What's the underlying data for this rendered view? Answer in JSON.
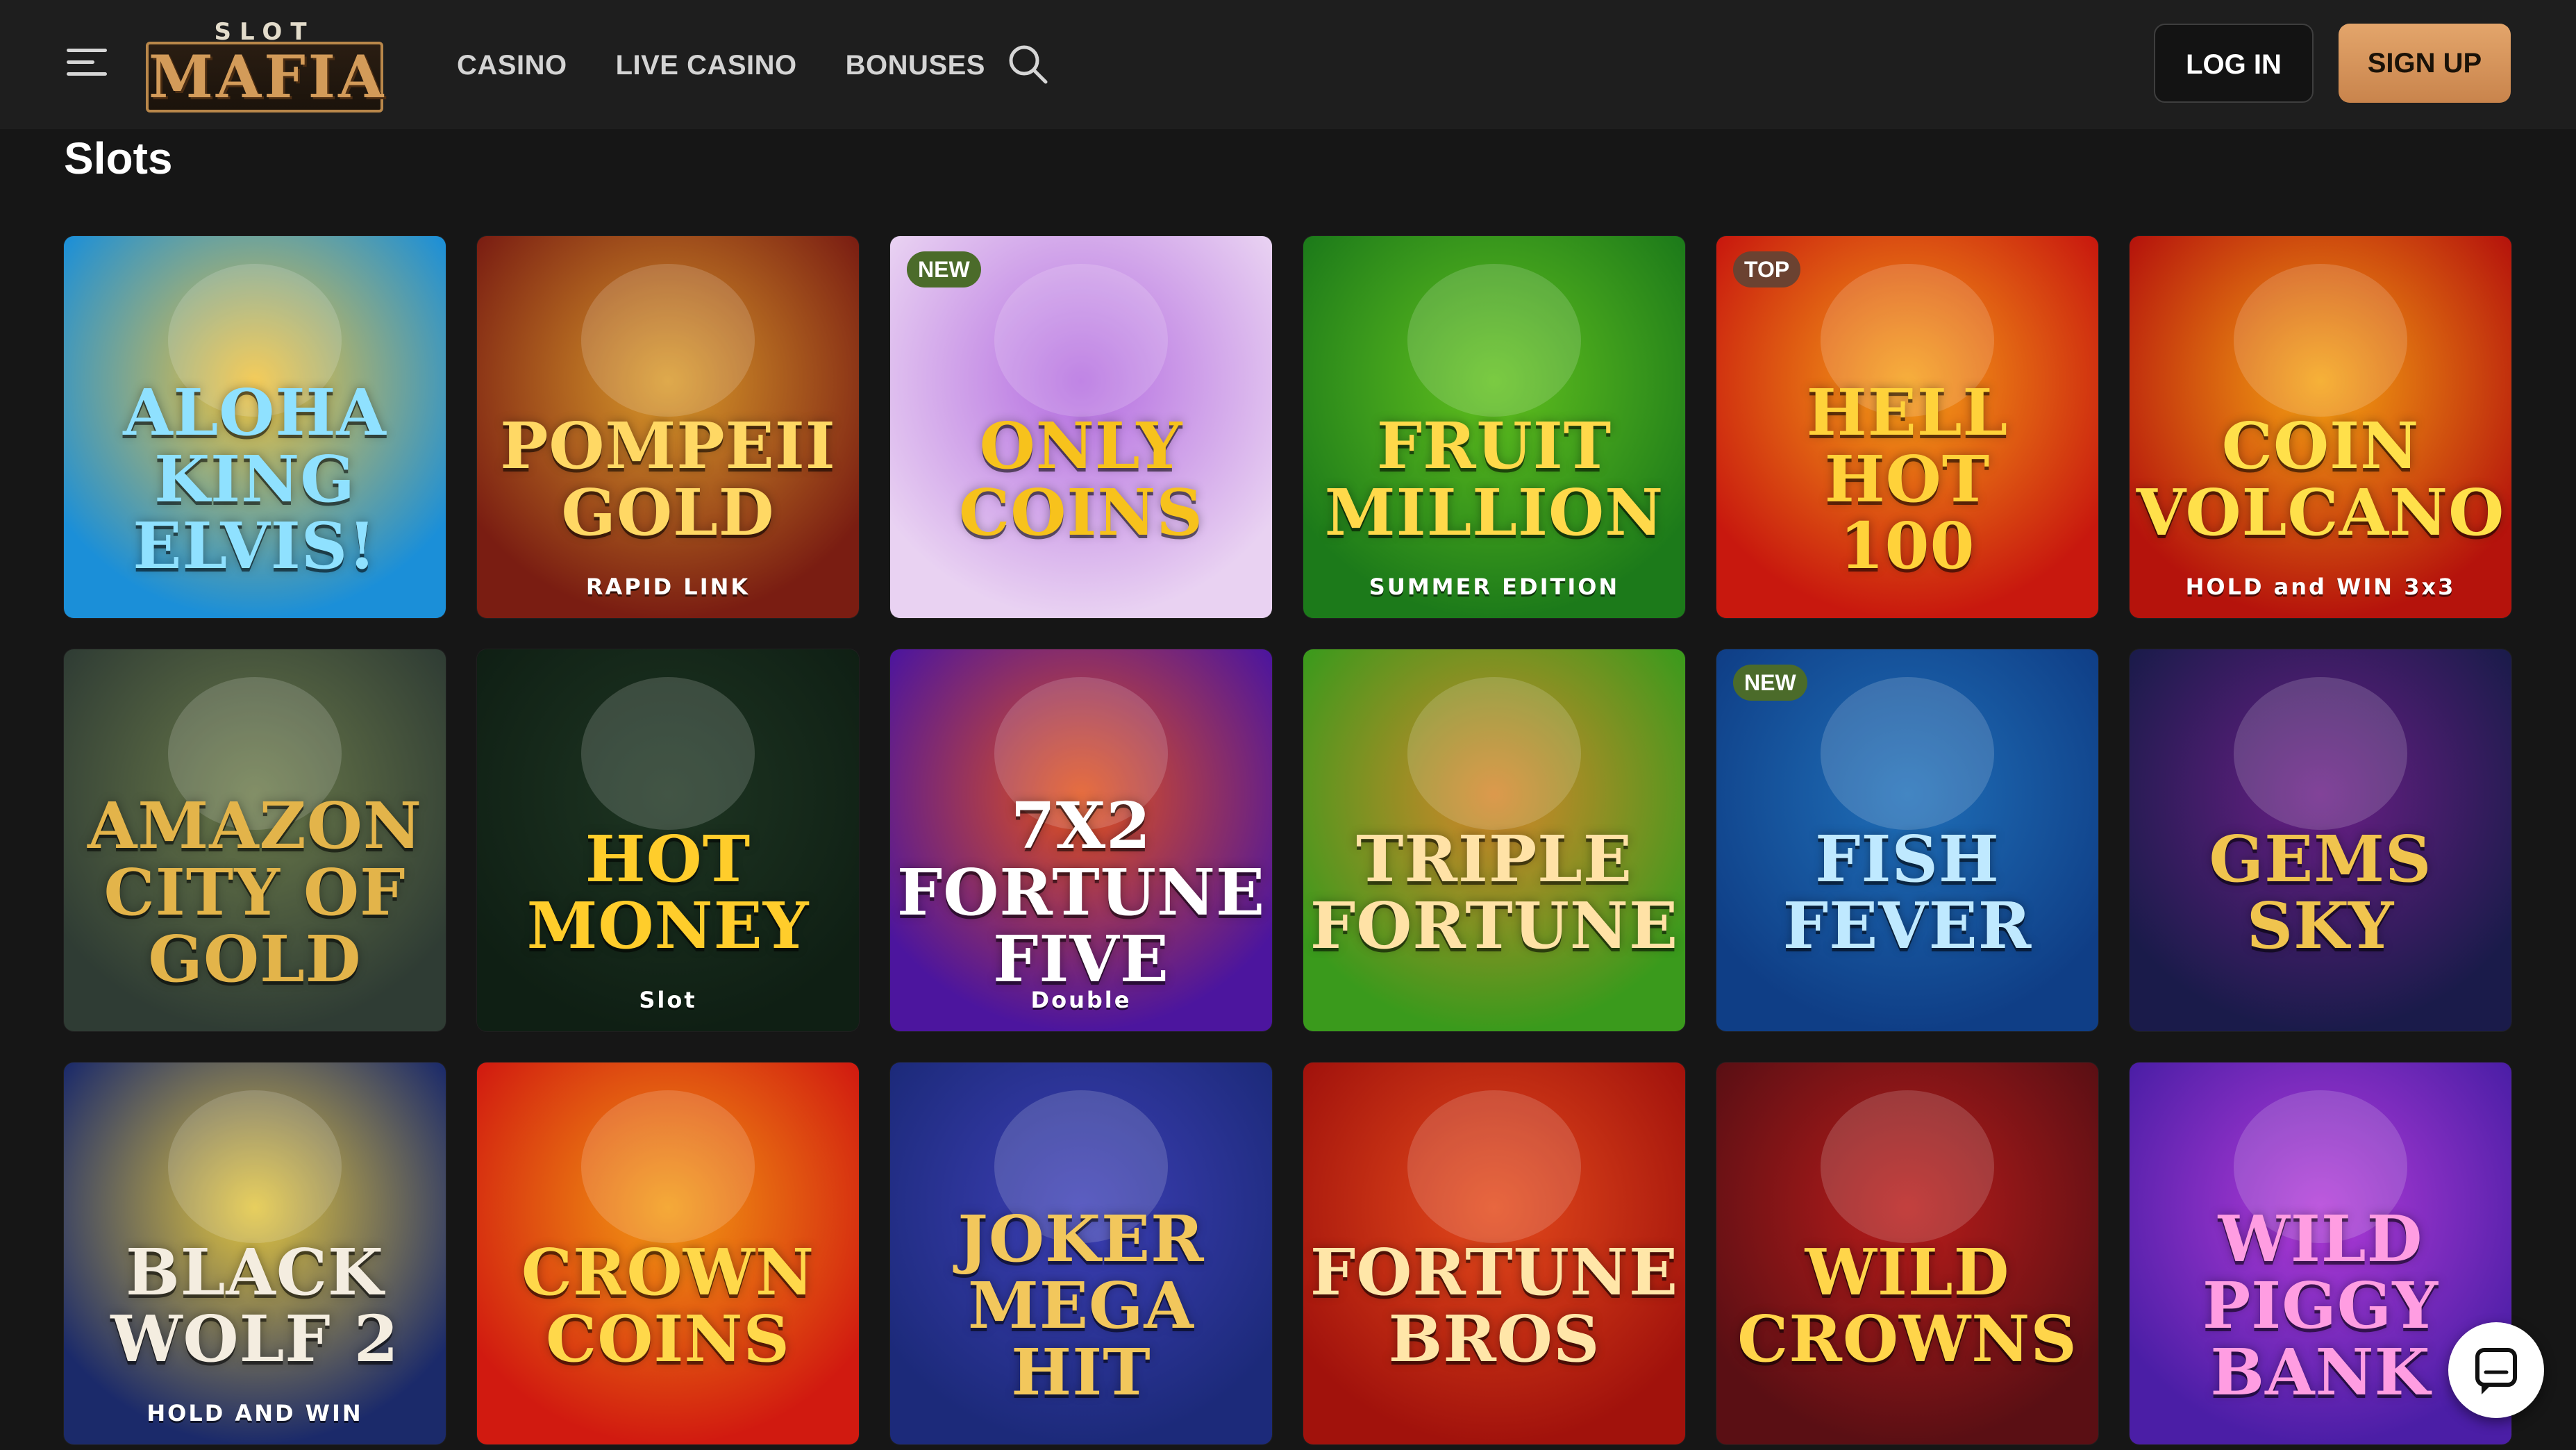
{
  "header": {
    "logo_top": "SLOT",
    "logo_main": "MAFIA",
    "nav": [
      {
        "label": "CASINO"
      },
      {
        "label": "LIVE CASINO"
      },
      {
        "label": "BONUSES"
      }
    ],
    "login_label": "LOG IN",
    "signup_label": "SIGN UP"
  },
  "page": {
    "title": "Slots"
  },
  "games": [
    {
      "title": "Aloha\nKing Elvis!",
      "subtitle": "",
      "badge": "",
      "colors": [
        "#1b8fd8",
        "#f2c23b"
      ],
      "title_color": "#8fe1ff"
    },
    {
      "title": "Pompeii\nGold",
      "subtitle": "RAPID LINK",
      "badge": "",
      "colors": [
        "#7a1d12",
        "#d99a2a"
      ],
      "title_color": "#ffd864"
    },
    {
      "title": "Only\nCoins",
      "subtitle": "",
      "badge": "NEW",
      "colors": [
        "#e9d2f2",
        "#b46de0"
      ],
      "title_color": "#f7c21c"
    },
    {
      "title": "Fruit\nMillion",
      "subtitle": "SUMMER EDITION",
      "badge": "",
      "colors": [
        "#1c7a1a",
        "#62c11e"
      ],
      "title_color": "#ffd94a"
    },
    {
      "title": "Hell Hot\n100",
      "subtitle": "",
      "badge": "TOP",
      "colors": [
        "#c8180e",
        "#f6a017"
      ],
      "title_color": "#ffd23a"
    },
    {
      "title": "Coin\nVolcano",
      "subtitle": "HOLD and WIN 3x3",
      "badge": "",
      "colors": [
        "#b5130c",
        "#f5a312"
      ],
      "title_color": "#ffe04a"
    },
    {
      "title": "Amazon\nCity of Gold",
      "subtitle": "",
      "badge": "",
      "colors": [
        "#2f3c34",
        "#6b7a4a"
      ],
      "title_color": "#e3b44a"
    },
    {
      "title": "Hot\nMoney",
      "subtitle": "Slot",
      "badge": "",
      "colors": [
        "#0f1f14",
        "#1e3522"
      ],
      "title_color": "#ffcd2b"
    },
    {
      "title": "7x2\nFortune Five",
      "subtitle": "Double",
      "badge": "",
      "colors": [
        "#4c159e",
        "#e2521b"
      ],
      "title_color": "#ffffff"
    },
    {
      "title": "Triple\nFortune",
      "subtitle": "",
      "badge": "",
      "colors": [
        "#3a9a1c",
        "#d6862a"
      ],
      "title_color": "#ffe2a6"
    },
    {
      "title": "Fish\nFever",
      "subtitle": "",
      "badge": "NEW",
      "colors": [
        "#0f3e86",
        "#1f6fb8"
      ],
      "title_color": "#bfe9ff"
    },
    {
      "title": "Gems\nSky",
      "subtitle": "",
      "badge": "",
      "colors": [
        "#1a1b4a",
        "#6a1f86"
      ],
      "title_color": "#f0c44e"
    },
    {
      "title": "Black\nWolf 2",
      "subtitle": "HOLD AND WIN",
      "badge": "",
      "colors": [
        "#1b2a6a",
        "#e3c640"
      ],
      "title_color": "#f4ede0"
    },
    {
      "title": "Crown\nCoins",
      "subtitle": "",
      "badge": "",
      "colors": [
        "#d11a10",
        "#f39a12"
      ],
      "title_color": "#ffd84a"
    },
    {
      "title": "Joker\nMega Hit",
      "subtitle": "",
      "badge": "",
      "colors": [
        "#1c2a7a",
        "#3d3fb6"
      ],
      "title_color": "#f2c75c"
    },
    {
      "title": "Fortune\nBros",
      "subtitle": "",
      "badge": "",
      "colors": [
        "#a1120c",
        "#e44a1b"
      ],
      "title_color": "#ffe6a8"
    },
    {
      "title": "Wild\nCrowns",
      "subtitle": "",
      "badge": "",
      "colors": [
        "#5a0f14",
        "#b81c1a"
      ],
      "title_color": "#ffd54a"
    },
    {
      "title": "Wild\nPiggy Bank",
      "subtitle": "",
      "badge": "",
      "colors": [
        "#4b1ea6",
        "#b23bd8"
      ],
      "title_color": "#ff9de2"
    }
  ],
  "icons": {
    "menu": "hamburger-menu-icon",
    "search": "search-icon",
    "chat": "chat-bubble-icon"
  }
}
